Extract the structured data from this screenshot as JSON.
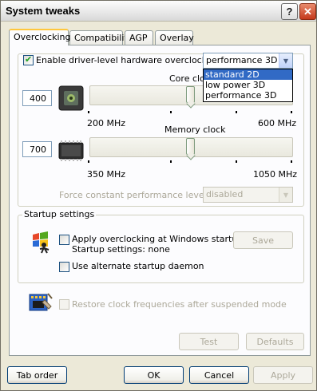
{
  "window": {
    "title": "System tweaks",
    "help_label": "?",
    "close_label": "✕"
  },
  "tabs": [
    {
      "label": "Overclocking",
      "active": true
    },
    {
      "label": "Compatibility",
      "active": false
    },
    {
      "label": "AGP",
      "active": false
    },
    {
      "label": "Overlay",
      "active": false
    }
  ],
  "overclocking": {
    "enable_label": "Enable driver-level hardware overclocking",
    "enable_checked": true,
    "mode_select": {
      "value": "performance 3D",
      "options": [
        "standard 2D",
        "low power 3D",
        "performance 3D"
      ],
      "highlighted": "standard 2D"
    },
    "core": {
      "label": "Core clock",
      "value": "400",
      "min_label": "200 MHz",
      "max_label": "600 MHz",
      "min": 200,
      "max": 600,
      "current": 400
    },
    "memory": {
      "label": "Memory clock",
      "value": "700",
      "min_label": "350 MHz",
      "max_label": "1050 MHz",
      "min": 350,
      "max": 1050,
      "current": 700
    },
    "force_label": "Force constant performance level",
    "force_value": "disabled"
  },
  "startup": {
    "group_label": "Startup settings",
    "apply_label": "Apply overclocking at Windows startup",
    "apply_status": "Startup settings: none",
    "save_label": "Save",
    "daemon_label": "Use alternate startup daemon"
  },
  "restore_label": "Restore clock frequencies after suspended mode",
  "panel_buttons": {
    "test": "Test",
    "defaults": "Defaults"
  },
  "footer": {
    "tab_order": "Tab order",
    "ok": "OK",
    "cancel": "Cancel",
    "apply": "Apply"
  }
}
